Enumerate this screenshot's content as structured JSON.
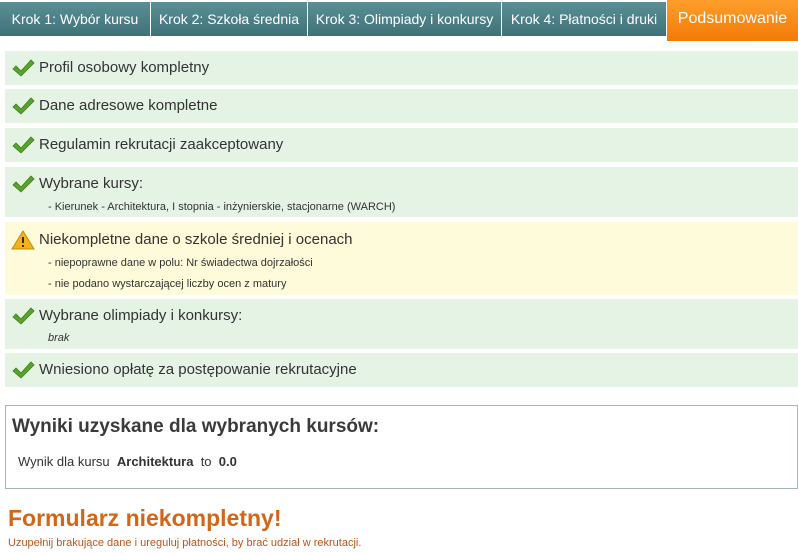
{
  "tabs": [
    {
      "label": "Krok 1: Wybór kursu",
      "active": false
    },
    {
      "label": "Krok 2: Szkoła średnia",
      "active": false
    },
    {
      "label": "Krok 3: Olimpiady i konkursy",
      "active": false
    },
    {
      "label": "Krok 4: Płatności i druki",
      "active": false
    },
    {
      "label": "Podsumowanie",
      "active": true
    }
  ],
  "status_items": [
    {
      "status": "ok",
      "icon": "checkmark-icon",
      "title": "Profil osobowy kompletny",
      "details": []
    },
    {
      "status": "ok",
      "icon": "checkmark-icon",
      "title": "Dane adresowe kompletne",
      "details": []
    },
    {
      "status": "ok",
      "icon": "checkmark-icon",
      "title": "Regulamin rekrutacji zaakceptowany",
      "details": []
    },
    {
      "status": "ok",
      "icon": "checkmark-icon",
      "title": "Wybrane kursy:",
      "details": [
        "- Kierunek - Architektura, I stopnia - inżynierskie, stacjonarne (WARCH)"
      ]
    },
    {
      "status": "warning",
      "icon": "warning-icon",
      "title": "Niekompletne dane o szkole średniej i ocenach",
      "details": [
        "- niepoprawne dane w polu: Nr świadectwa dojrzałości",
        "- nie podano wystarczającej liczby ocen z matury"
      ]
    },
    {
      "status": "ok",
      "icon": "checkmark-icon",
      "title": "Wybrane olimpiady i konkursy:",
      "details": [
        "brak"
      ]
    },
    {
      "status": "ok",
      "icon": "checkmark-icon",
      "title": "Wniesiono opłatę za postępowanie rekrutacyjne",
      "details": []
    }
  ],
  "results": {
    "heading": "Wyniki uzyskane dla wybranych kursów:",
    "prefix": "Wynik dla kursu",
    "course": "Architektura",
    "middle": "to",
    "score": "0.0"
  },
  "summary": {
    "title": "Formularz niekompletny!",
    "note": "Uzupełnij brakujące dane i ureguluj płatności, by brać udział w rekrutacji."
  },
  "colors": {
    "tab": "#4a7f86",
    "tab_active": "#f58a12",
    "ok_row": "#e4f3e4",
    "warning_row": "#fdfbd9",
    "check": "#5aa32a",
    "warning": "#e8a315",
    "incomplete": "#d4661a"
  }
}
